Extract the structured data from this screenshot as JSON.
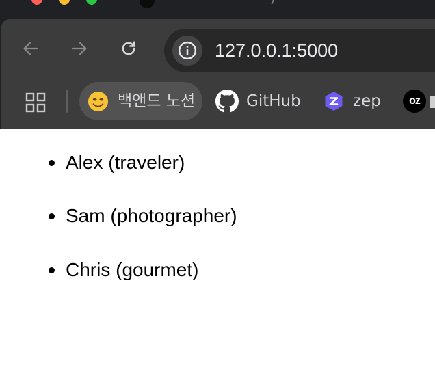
{
  "browser": {
    "address_bar": {
      "url": "127.0.0.1:5000"
    },
    "bookmarks": [
      {
        "label": "백앤드 노션",
        "icon": "smiling-face-emoji-icon",
        "highlighted": true
      },
      {
        "label": "GitHub",
        "icon": "github-icon"
      },
      {
        "label": "zep",
        "icon": "zep-icon"
      },
      {
        "label": "",
        "icon": "oz-icon",
        "icon_text": "oz"
      }
    ],
    "colors": {
      "toolbar": "#3c3c3c",
      "tabstrip": "#202124",
      "omnibox": "#282828",
      "zep_accent": "#6e5bf4"
    }
  },
  "page": {
    "people": [
      "Alex (traveler)",
      "Sam (photographer)",
      "Chris (gourmet)"
    ]
  }
}
